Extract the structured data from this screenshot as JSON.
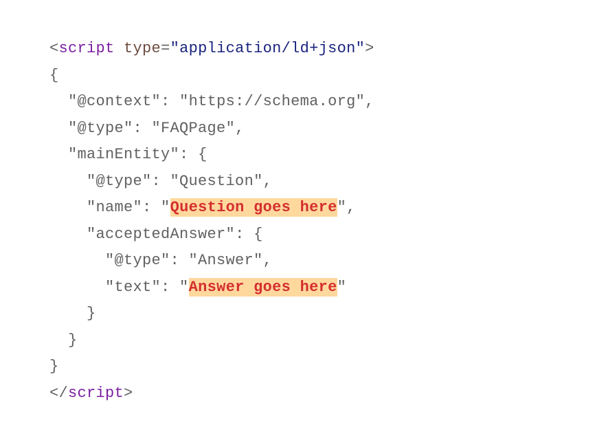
{
  "code": {
    "openTag": {
      "lt": "<",
      "tagName": "script",
      "space": " ",
      "attrName": "type",
      "eq": "=",
      "q1": "\"",
      "attrValue": "application/ld+json",
      "q2": "\"",
      "gt": ">"
    },
    "line2": "{",
    "line3": {
      "indent": "  ",
      "key": "\"@context\"",
      "colon": ": ",
      "value": "\"https://schema.org\"",
      "comma": ","
    },
    "line4": {
      "indent": "  ",
      "key": "\"@type\"",
      "colon": ": ",
      "value": "\"FAQPage\"",
      "comma": ","
    },
    "line5": {
      "indent": "  ",
      "key": "\"mainEntity\"",
      "colon": ": ",
      "brace": "{"
    },
    "line6": {
      "indent": "    ",
      "key": "\"@type\"",
      "colon": ": ",
      "value": "\"Question\"",
      "comma": ","
    },
    "line7": {
      "indent": "    ",
      "key": "\"name\"",
      "colon": ": ",
      "q1": "\"",
      "highlighted": "Question goes here",
      "q2": "\"",
      "comma": ","
    },
    "line8": {
      "indent": "    ",
      "key": "\"acceptedAnswer\"",
      "colon": ": ",
      "brace": "{"
    },
    "line9": {
      "indent": "      ",
      "key": "\"@type\"",
      "colon": ": ",
      "value": "\"Answer\"",
      "comma": ","
    },
    "line10": {
      "indent": "      ",
      "key": "\"text\"",
      "colon": ": ",
      "q1": "\"",
      "highlighted": "Answer goes here",
      "q2": "\""
    },
    "line11": "    }",
    "line12": "  }",
    "line13": "}",
    "closeTag": {
      "lt": "</",
      "tagName": "script",
      "gt": ">"
    }
  }
}
